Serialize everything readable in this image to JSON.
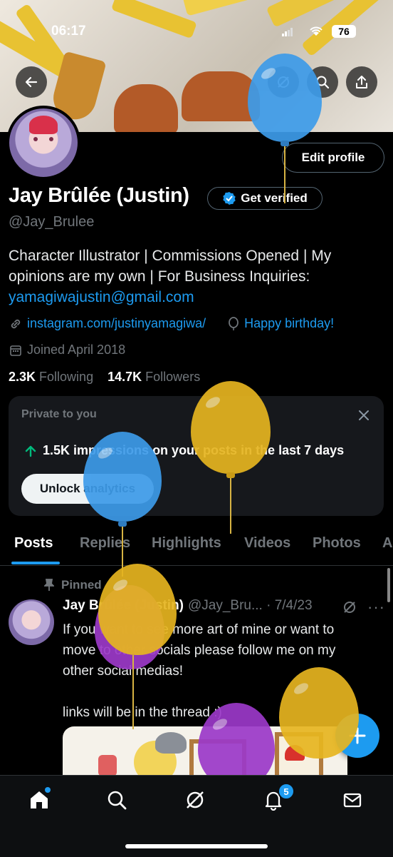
{
  "status_bar": {
    "time": "06:17",
    "battery": "76"
  },
  "profile": {
    "name": "Jay Brûlée (Justin)",
    "handle": "@Jay_Brulee",
    "edit_profile_label": "Edit profile",
    "get_verified_label": "Get verified",
    "bio_line1": "Character Illustrator | Commissions Opened | My",
    "bio_line2": "opinions are my own | For Business Inquiries:",
    "bio_email": "yamagiwajustin@gmail.com",
    "website": "instagram.com/justinyamagiwa/",
    "birthday": "Happy birthday!",
    "joined": "Joined April 2018",
    "following_count": "2.3K",
    "following_label": "Following",
    "followers_count": "14.7K",
    "followers_label": "Followers"
  },
  "private_card": {
    "title": "Private to you",
    "impressions": "1.5K impressions on your posts in the last 7 days",
    "unlock_label": "Unlock analytics"
  },
  "tabs": [
    "Posts",
    "Replies",
    "Highlights",
    "Videos",
    "Photos",
    "A"
  ],
  "post": {
    "pinned_label": "Pinned",
    "author": "Jay Brûlée (Justin)",
    "handle_date": "@Jay_Bru... · 7/4/23",
    "text_line1": "If you want to see more art of mine or want to",
    "text_line2": "move to other socials please follow me on my",
    "text_line3": "other social medias!",
    "text_line4": "links will be in the thread :)"
  },
  "fab_label": "+",
  "navbar": {
    "notifications_badge": "5"
  },
  "colors": {
    "accent": "#1d9bf0",
    "background": "#000000",
    "card": "#16181c",
    "muted": "#71767b",
    "up_arrow": "#00ba7c"
  },
  "icons": [
    "back-arrow-icon",
    "grok-icon",
    "search-icon",
    "share-icon",
    "verified-badge-icon",
    "link-icon",
    "balloon-icon",
    "calendar-icon",
    "close-icon",
    "arrow-up-icon",
    "pin-icon",
    "more-icon",
    "home-icon",
    "notifications-icon",
    "mail-icon",
    "compose-icon"
  ]
}
